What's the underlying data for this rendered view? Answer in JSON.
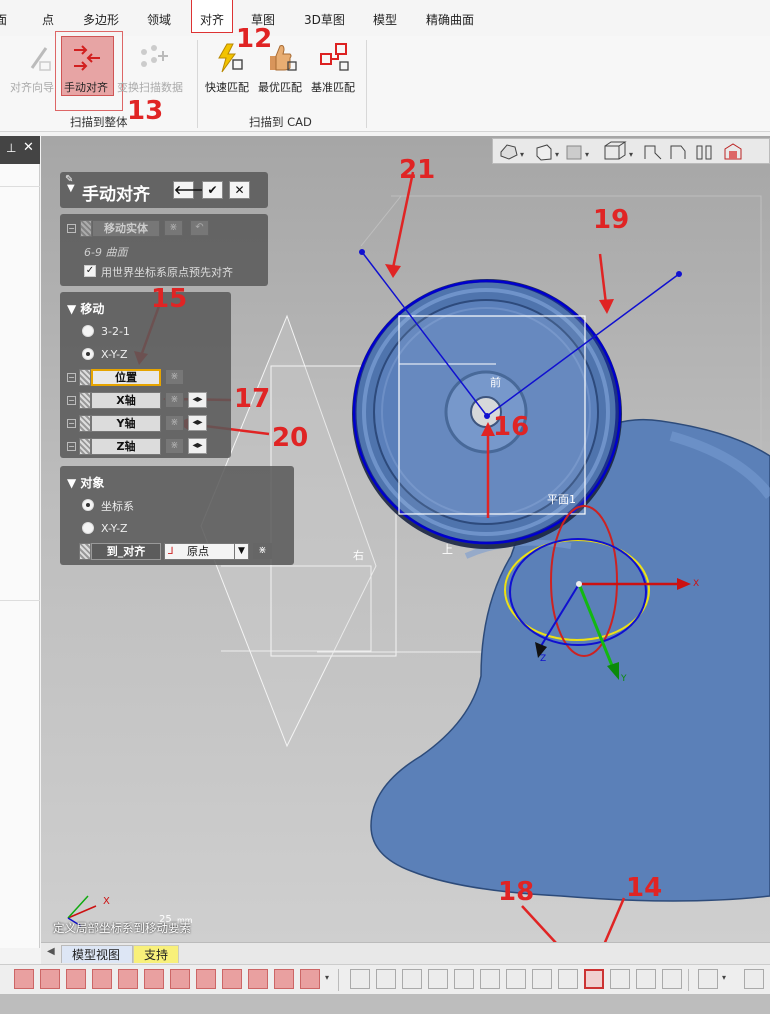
{
  "menu": {
    "items": [
      {
        "label": "面",
        "active": false
      },
      {
        "label": "点",
        "active": false
      },
      {
        "label": "多边形",
        "active": false
      },
      {
        "label": "领域",
        "active": false
      },
      {
        "label": "对齐",
        "active": true
      },
      {
        "label": "草图",
        "active": false
      },
      {
        "label": "3D草图",
        "active": false
      },
      {
        "label": "模型",
        "active": false
      },
      {
        "label": "精确曲面",
        "active": false
      }
    ]
  },
  "ribbon": {
    "buttons": {
      "align_wizard": "对齐向导",
      "manual_align": "手动对齐",
      "transform_scan": "变换扫描数据",
      "quick_match": "快速匹配",
      "best_match": "最优匹配",
      "datum_match": "基准匹配"
    },
    "groups": {
      "scan_to_whole": "扫描到整体",
      "scan_to_cad": "扫描到 CAD"
    }
  },
  "dialog": {
    "title": "手动对齐",
    "move_entity": {
      "label": "移动实体",
      "item": "6-9 曲面",
      "checkbox_label": "用世界坐标系原点预先对齐",
      "checked": true
    },
    "move": {
      "header": "移动",
      "option1": "3-2-1",
      "option2": "X-Y-Z",
      "selected": "X-Y-Z",
      "position": "位置",
      "x_axis": "X轴",
      "y_axis": "Y轴",
      "z_axis": "Z轴"
    },
    "object": {
      "header": "对象",
      "option1": "坐标系",
      "option2": "X-Y-Z",
      "selected": "坐标系",
      "field_label": "到_对齐",
      "combo_value": "原点"
    }
  },
  "viewport": {
    "labels": {
      "front": "前",
      "right": "右",
      "top": "上",
      "plane1": "平面1",
      "axis_x": "X",
      "axis_y": "Y",
      "axis_z": "Z",
      "scale_value": "25",
      "scale_unit": "mm"
    },
    "hint": "定义局部坐标系到移动要素",
    "colors": {
      "model_blue": "#5b80b8",
      "accent_red": "#e02424",
      "ring_yellow": "#f2e400"
    }
  },
  "bottom_tabs": {
    "tab1": "模型视图",
    "tab2": "支持"
  },
  "annotations": [
    "12",
    "13",
    "14",
    "15",
    "16",
    "17",
    "18",
    "19",
    "20",
    "21"
  ]
}
